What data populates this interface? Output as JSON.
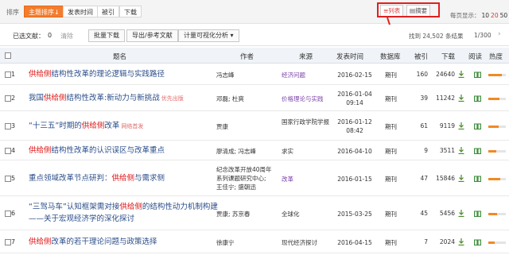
{
  "sortbar": {
    "label": "排序",
    "buttons": [
      "主题排序↓",
      "发表时间",
      "被引",
      "下载"
    ],
    "view_list": "≡列表",
    "view_abstract": "▤摘要",
    "perpage_label": "每页显示：",
    "perpage_options": [
      "10",
      "20",
      "50"
    ]
  },
  "toolbar": {
    "selected_label": "已选文献：",
    "selected_count": "0",
    "clear": "清除",
    "buttons": [
      "批量下载",
      "导出/参考文献",
      "计量可视化分析 ▾"
    ],
    "found": "找到 24,502 条结果",
    "pager": "1/300",
    "next": "›"
  },
  "columns": [
    "题名",
    "作者",
    "来源",
    "发表时间",
    "数据库",
    "被引",
    "下载",
    "阅读",
    "热度"
  ],
  "rows": [
    {
      "num": "1",
      "pre": "",
      "hl": "供给侧",
      "post": "结构性改革的理论逻辑与实践路径",
      "tag": "",
      "author": "冯志峰",
      "source": "经济问题",
      "source_link": true,
      "date": "2016-02-15",
      "db": "期刊",
      "cite": "160",
      "download": "24640",
      "heat": 0.78
    },
    {
      "num": "2",
      "pre": "我国",
      "hl": "供给侧",
      "post": "结构性改革:新动力与新挑战",
      "tag": "优先出版",
      "author": "邓磊; 杜爽",
      "source": "价格理论与实践",
      "source_link": true,
      "date": "2016-01-04 09:14",
      "db": "期刊",
      "cite": "39",
      "download": "11242",
      "heat": 0.62
    },
    {
      "num": "3",
      "pre": "“十三五”时期的",
      "hl": "供给侧",
      "post": "改革",
      "tag": "网络首发",
      "author": "贾康",
      "source": "国家行政学院学报",
      "source_link": false,
      "date": "2016-01-12 08:42",
      "db": "期刊",
      "cite": "61",
      "download": "9119",
      "heat": 0.58
    },
    {
      "num": "4",
      "pre": "",
      "hl": "供给侧",
      "post": "结构性改革的认识误区与改革重点",
      "tag": "",
      "author": "廖清成; 冯志峰",
      "source": "求实",
      "source_link": false,
      "date": "2016-04-10",
      "db": "期刊",
      "cite": "9",
      "download": "3511",
      "heat": 0.46
    },
    {
      "num": "5",
      "pre": "重点领域改革节点研判：",
      "hl": "供给侧",
      "post": "与需求侧",
      "tag": "",
      "author": "纪念改革开放40周年系列课题研究中心; 王佳宁; 盛朝迅",
      "source": "改革",
      "source_link": true,
      "date": "2016-01-15",
      "db": "期刊",
      "cite": "47",
      "download": "15846",
      "heat": 0.66
    },
    {
      "num": "6",
      "pre": "“三驾马车”认知框架需对接",
      "hl": "供给侧",
      "post": "的结构性动力机制构建——关于宏观经济学的深化探讨",
      "tag": "",
      "author": "贾康; 苏京春",
      "source": "全球化",
      "source_link": false,
      "date": "2015-03-25",
      "db": "期刊",
      "cite": "45",
      "download": "5456",
      "heat": 0.5
    },
    {
      "num": "7",
      "pre": "",
      "hl": "供给侧",
      "post": "改革的若干理论问题与政策选择",
      "tag": "",
      "author": "徐康宁",
      "source": "现代经济探讨",
      "source_link": false,
      "date": "2016-04-15",
      "db": "期刊",
      "cite": "7",
      "download": "2024",
      "heat": 0.36
    }
  ],
  "colors": {
    "accent": "#f47c2c",
    "title_link": "#2a4d8a",
    "highlight": "#d11111",
    "source_link": "#7a3fa8",
    "annotation": "#e02020"
  }
}
